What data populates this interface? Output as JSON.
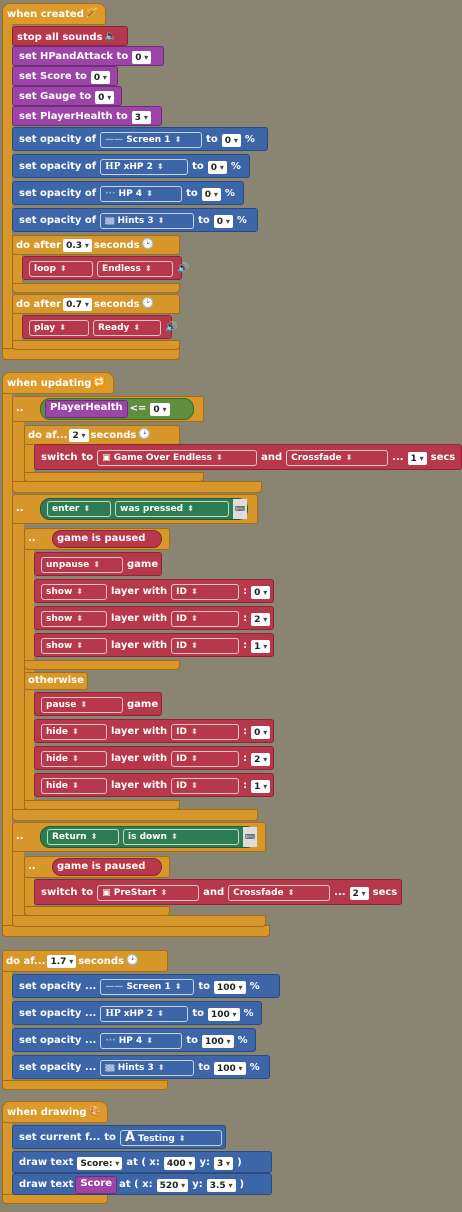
{
  "created": {
    "hat": "when created",
    "stop_sounds": "stop all sounds",
    "set_hp": {
      "pre": "set HPandAttack to",
      "val": "0"
    },
    "set_score": {
      "pre": "set Score to",
      "val": "0"
    },
    "set_gauge": {
      "pre": "set Gauge to",
      "val": "0"
    },
    "set_health": {
      "pre": "set PlayerHealth to",
      "val": "3"
    },
    "opacity_lbl": "set opacity of",
    "to": "to",
    "pct": "%",
    "op1": {
      "obj": "Screen 1",
      "val": "0"
    },
    "op2": {
      "obj": "xHP 2",
      "prefix": "HP",
      "val": "0"
    },
    "op3": {
      "obj": "HP 4",
      "val": "0"
    },
    "op4": {
      "obj": "Hints 3",
      "val": "0"
    },
    "doafter": "do after",
    "seconds": "seconds",
    "da1": "0.3",
    "loop": "loop",
    "endless": "Endless",
    "da2": "0.7",
    "play": "play",
    "ready": "Ready"
  },
  "updating": {
    "hat": "when updating",
    "dots": "..",
    "player_health": "PlayerHealth",
    "lte": "<=",
    "hval": "0",
    "doaf": "do af...",
    "daval": "2",
    "seconds": "seconds",
    "switch": "switch",
    "to": "to",
    "scene1": "Game Over Endless",
    "and": "and",
    "crossfade": "Crossfade",
    "ell": "...",
    "secs": "secs",
    "sval1": "1",
    "enter": "enter",
    "was_pressed": "was pressed",
    "paused": "game is paused",
    "unpause": "unpause",
    "game": "game",
    "show": "show",
    "hide": "hide",
    "layer_with": "layer with",
    "id": "ID",
    "colon": ":",
    "ids": [
      "0",
      "2",
      "1"
    ],
    "otherwise": "otherwise",
    "pause": "pause",
    "return": "Return",
    "is_down": "is down",
    "scene2": "PreStart",
    "sval2": "2"
  },
  "after": {
    "doaf": "do af...",
    "val": "1.7",
    "seconds": "seconds",
    "op_lbl": "set opacity ...",
    "to": "to",
    "pct": "%",
    "ops": [
      {
        "obj": "Screen 1",
        "val": "100"
      },
      {
        "obj": "xHP 2",
        "prefix": "HP",
        "val": "100"
      },
      {
        "obj": "HP 4",
        "val": "100"
      },
      {
        "obj": "Hints 3",
        "val": "100"
      }
    ]
  },
  "drawing": {
    "hat": "when drawing",
    "set_font": "set current f...",
    "to": "to",
    "font_letter": "A",
    "font": "Testing",
    "draw_text": "draw text",
    "t1": "Score:",
    "t2": "Score",
    "at": "at ( x:",
    "y": "y:",
    "close": ")",
    "x1": "400",
    "y1": "3",
    "x2": "520",
    "y2": "3.5"
  }
}
